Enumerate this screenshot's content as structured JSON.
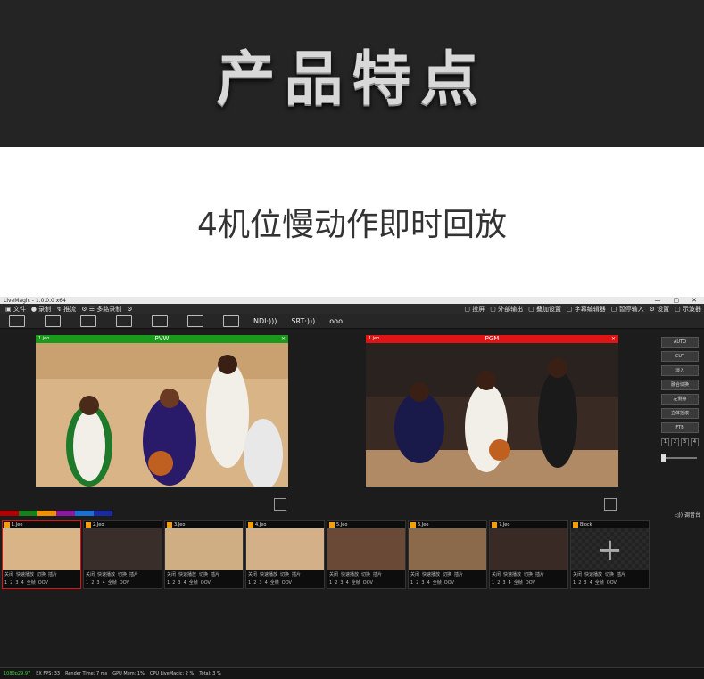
{
  "banner": {
    "title": "产品特点"
  },
  "subband": {
    "subtitle": "4机位慢动作即时回放"
  },
  "app": {
    "window_title": "LiveMagic - 1.0.0.0 x64",
    "window_buttons": [
      "—",
      "▢",
      "✕"
    ],
    "menu_left": [
      "▣ 文件",
      "● 录制",
      "↯ 推流",
      "⚙ ☰ 多路录制",
      "⚙"
    ],
    "menu_right": [
      "▢ 投屏",
      "▢ 外部输出",
      "▢ 叠加设置",
      "▢ 字幕编辑器",
      "▢ 暂停输入",
      "⚙ 设置",
      "▢ 示波器"
    ],
    "toolbar_text": [
      "NDI·)))",
      "SRT·)))",
      "ooo"
    ],
    "pvw": {
      "label": "1.jeo",
      "title": "PVW"
    },
    "pgm": {
      "label": "1.jeo",
      "title": "PGM"
    },
    "controls": [
      "AUTO",
      "CUT",
      "淡入",
      "融合切换",
      "左侧擦",
      "立体摇滚",
      "FTB"
    ],
    "control_nums": [
      "1",
      "2",
      "3",
      "4"
    ],
    "right_label": "◁)) 调音台",
    "colors": [
      "#b00000",
      "#15801a",
      "#f09000",
      "#8a1aa0",
      "#1a70d0",
      "#1a2aa0"
    ],
    "cams": [
      {
        "name": "1.Jeo",
        "active": true
      },
      {
        "name": "2.Jeo",
        "active": false
      },
      {
        "name": "3.Jeo",
        "active": false
      },
      {
        "name": "4.Jeo",
        "active": false
      },
      {
        "name": "5.Jeo",
        "active": false
      },
      {
        "name": "6.Jeo",
        "active": false
      },
      {
        "name": "7.Jeo",
        "active": false
      },
      {
        "name": "Block",
        "active": false
      }
    ],
    "cam_bar": [
      "关闭",
      "快速播放",
      "切换",
      "插片"
    ],
    "cam_nums": [
      "1",
      "2",
      "3",
      "4",
      "全帧",
      "OOV",
      "▢",
      "⚙"
    ],
    "status": {
      "res": "1080p29.97",
      "items": [
        "EX FPS: 33",
        "Render Time: 7 ms",
        "GPU Mem: 1%",
        "CPU LiveMagic: 2 %",
        "Total: 3 %"
      ]
    }
  }
}
